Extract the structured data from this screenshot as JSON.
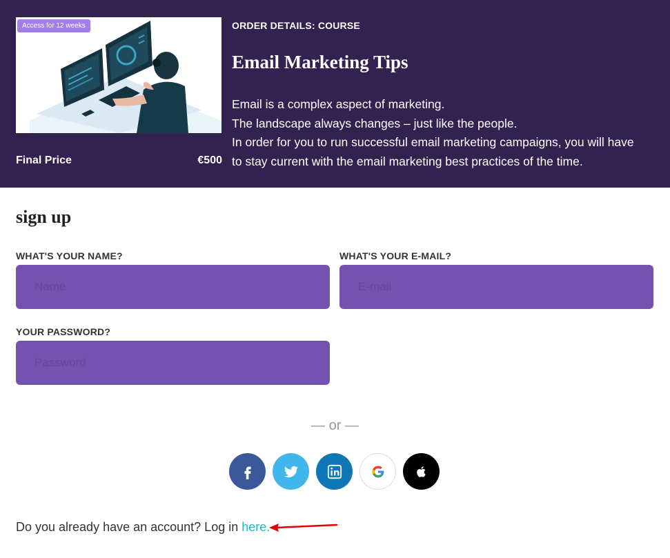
{
  "order": {
    "badge": "Access for 12 weeks",
    "details_label": "ORDER DETAILS: COURSE",
    "title": "Email Marketing Tips",
    "description_lines": [
      "Email is a complex aspect of marketing.",
      "The landscape always changes – just like the people.",
      "In order for you to run successful email marketing campaigns, you will have",
      "to stay current with the email marketing best practices of the time."
    ],
    "final_price_label": "Final Price",
    "final_price": "€500"
  },
  "signup": {
    "title": "sign up",
    "name_label": "WHAT'S YOUR NAME?",
    "name_placeholder": "Name",
    "name_value": "",
    "email_label": "WHAT'S YOUR E-MAIL?",
    "email_placeholder": "E-mail",
    "email_value": "",
    "password_label": "YOUR PASSWORD?",
    "password_placeholder": "Password",
    "password_value": ""
  },
  "social": {
    "divider": "— or —",
    "buttons": [
      {
        "icon": "facebook-icon",
        "color": "#3b5998"
      },
      {
        "icon": "twitter-icon",
        "color": "#41b6ed"
      },
      {
        "icon": "linkedin-icon",
        "color": "#0f77b5"
      },
      {
        "icon": "google-icon",
        "color": "#ffffff"
      },
      {
        "icon": "apple-icon",
        "color": "#000000"
      }
    ]
  },
  "login": {
    "prompt": "Do you already have an account? Log in ",
    "link": "here."
  },
  "colors": {
    "header_bg": "#32224f",
    "input_bg": "#7452af",
    "badge_bg": "#a37dea",
    "link": "#2bb3c0",
    "annotation_arrow": "#e00000"
  }
}
